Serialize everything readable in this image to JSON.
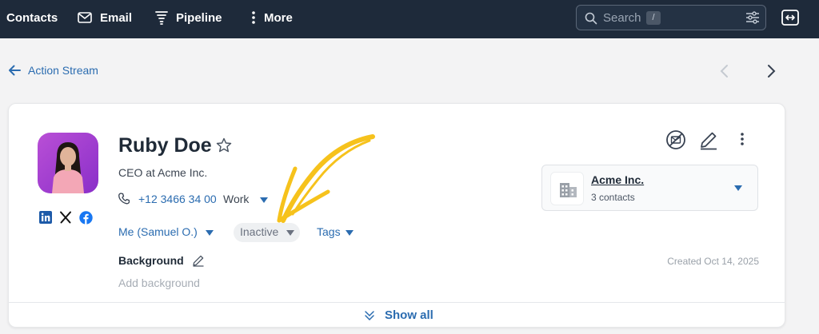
{
  "nav": {
    "contacts_label": "Contacts",
    "email_label": "Email",
    "pipeline_label": "Pipeline",
    "more_label": "More",
    "search_placeholder": "Search",
    "search_shortcut": "/"
  },
  "subheader": {
    "back_label": "Action Stream"
  },
  "contact": {
    "name": "Ruby Doe",
    "title": "CEO at Acme Inc.",
    "phone": "+12 3466 34 00",
    "phone_type": "Work",
    "owner": "Me (Samuel O.)",
    "status": "Inactive",
    "tags_label": "Tags",
    "background_label": "Background",
    "background_placeholder": "Add background",
    "created": "Created Oct 14, 2025",
    "social": [
      "linkedin-icon",
      "x-icon",
      "facebook-icon"
    ]
  },
  "company": {
    "name": "Acme Inc.",
    "contacts_count": "3 contacts"
  },
  "footer": {
    "show_all_label": "Show all"
  },
  "colors": {
    "nav_bg": "#1e2a3a",
    "link": "#2b6cb0",
    "annotation_arrow": "#f6c21c"
  }
}
